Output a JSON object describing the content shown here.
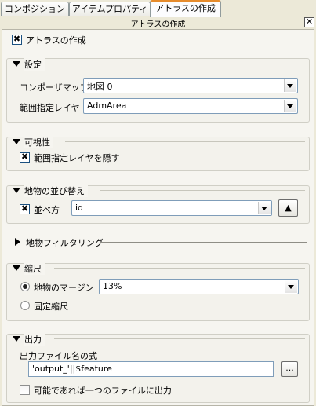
{
  "tabs": [
    "コンポジション",
    "アイテムプロパティ",
    "アトラスの作成"
  ],
  "dock_title": "アトラスの作成",
  "close_glyph": "✕",
  "generate_atlas": {
    "label": "アトラスの作成",
    "checked": true
  },
  "settings": {
    "title": "設定",
    "composer_map_label": "コンポーザマップ",
    "composer_map_value": "地図 0",
    "coverage_layer_label": "範囲指定レイヤ",
    "coverage_layer_value": "AdmArea"
  },
  "visibility": {
    "title": "可視性",
    "hide_coverage_label": "範囲指定レイヤを隠す",
    "hide_coverage_checked": true
  },
  "sorting": {
    "title": "地物の並び替え",
    "sort_label": "並べ方",
    "sort_checked": true,
    "sort_field": "id",
    "sort_dir_glyph": "▲"
  },
  "filtering": {
    "title": "地物フィルタリング"
  },
  "scale": {
    "title": "縮尺",
    "margin_label": "地物のマージン",
    "margin_value": "13%",
    "fixed_label": "固定縮尺"
  },
  "output": {
    "title": "出力",
    "filename_label": "出力ファイル名の式",
    "filename_value": "'output_'||$feature",
    "browse_label": "...",
    "single_file_label": "可能であれば一つのファイルに出力",
    "single_file_checked": false
  },
  "check_glyph": "✖"
}
